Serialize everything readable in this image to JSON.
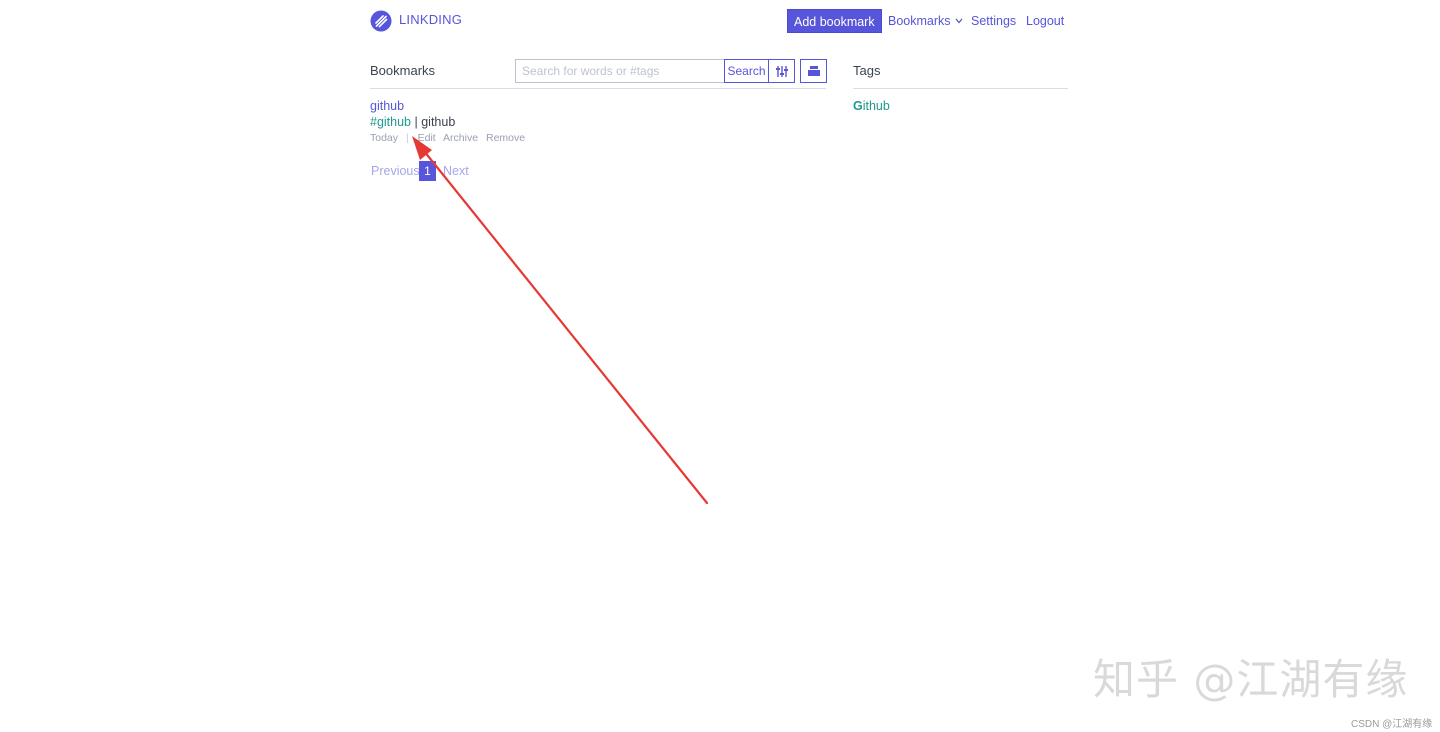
{
  "header": {
    "brand": "LINKDING",
    "add_bookmark": "Add bookmark",
    "nav_bookmarks": "Bookmarks",
    "nav_settings": "Settings",
    "nav_logout": "Logout"
  },
  "bookmarks": {
    "title": "Bookmarks",
    "search_placeholder": "Search for words or #tags",
    "search_button": "Search",
    "items": [
      {
        "title": "github",
        "tag": "#github",
        "separator": "|",
        "description": "github",
        "date": "Today",
        "meta_separator": "|",
        "actions": [
          "Edit",
          "Archive",
          "Remove"
        ]
      }
    ]
  },
  "pagination": {
    "previous": "Previous",
    "current_page": "1",
    "next": "Next"
  },
  "tags": {
    "title": "Tags",
    "items": [
      {
        "first_letter": "G",
        "rest": "ithub"
      }
    ]
  },
  "overlay": {
    "watermark": "知乎 @江湖有缘",
    "footnote": "CSDN @江湖有缘",
    "arrow_color": "#e53935"
  },
  "colors": {
    "primary": "#5755d9",
    "tag": "#1f9a8e",
    "muted": "#9aa0b3"
  }
}
